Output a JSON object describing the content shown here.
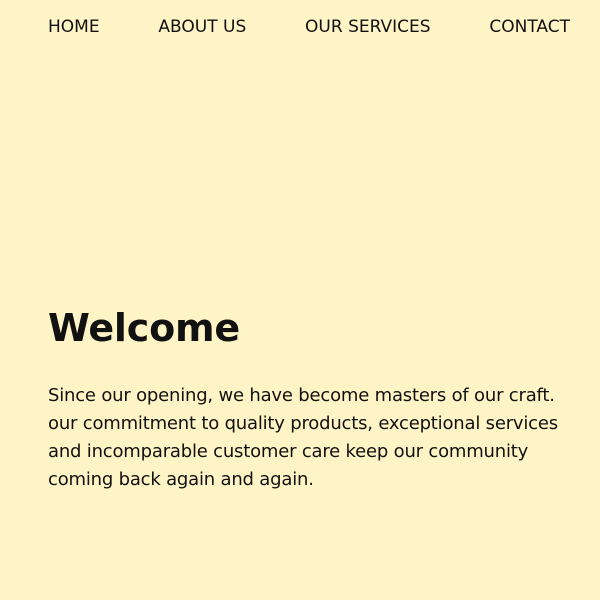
{
  "nav": {
    "items": [
      {
        "label": "HOME"
      },
      {
        "label": "ABOUT US"
      },
      {
        "label": "OUR SERVICES"
      },
      {
        "label": "CONTACT"
      }
    ]
  },
  "hero": {
    "title": "Welcome",
    "body": "Since our opening, we have become masters of our craft. our commitment to quality products, exceptional services and incomparable customer care keep our community coming back again and again."
  },
  "colors": {
    "background": "#FFF4C6",
    "text": "#111111"
  }
}
